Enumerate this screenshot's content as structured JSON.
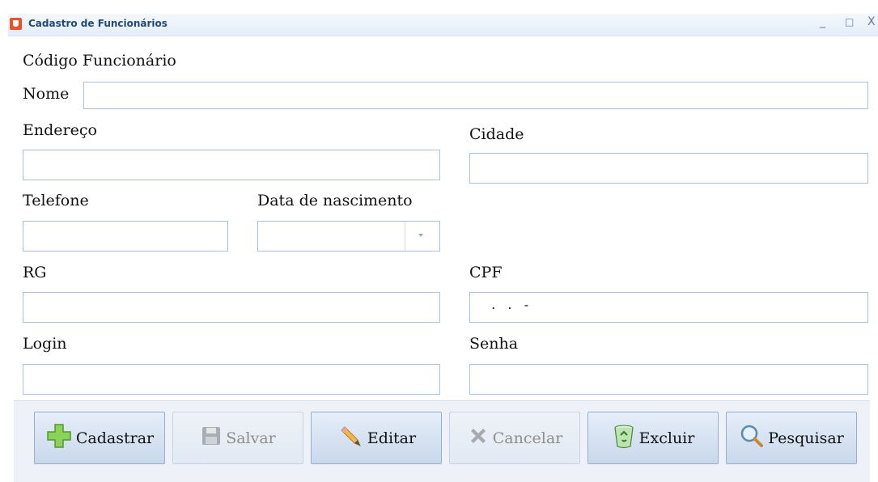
{
  "window": {
    "title": "Cadastro de Funcionários",
    "minimize": "_",
    "maximize": "□",
    "close": "X"
  },
  "form": {
    "codigo_label": "Código Funcionário",
    "nome_label": "Nome",
    "nome_value": "",
    "endereco_label": "Endereço",
    "endereco_value": "",
    "cidade_label": "Cidade",
    "cidade_value": "",
    "telefone_label": "Telefone",
    "telefone_value": "",
    "data_nascimento_label": "Data de nascimento",
    "data_nascimento_value": "",
    "rg_label": "RG",
    "rg_value": "",
    "cpf_label": "CPF",
    "cpf_mask": " .   .   -",
    "login_label": "Login",
    "login_value": "",
    "senha_label": "Senha",
    "senha_value": ""
  },
  "buttons": {
    "cadastrar": "Cadastrar",
    "salvar": "Salvar",
    "editar": "Editar",
    "cancelar": "Cancelar",
    "excluir": "Excluir",
    "pesquisar": "Pesquisar"
  },
  "icons": {
    "cadastrar": "plus-icon",
    "salvar": "floppy-disk-icon",
    "editar": "pencil-icon",
    "cancelar": "x-icon",
    "excluir": "recycle-bin-icon",
    "pesquisar": "magnifier-icon"
  },
  "colors": {
    "title_text": "#23497c",
    "field_border": "#a9c0de",
    "button_bg": "#c9d8ec",
    "disabled_text": "#8e8e8e"
  }
}
